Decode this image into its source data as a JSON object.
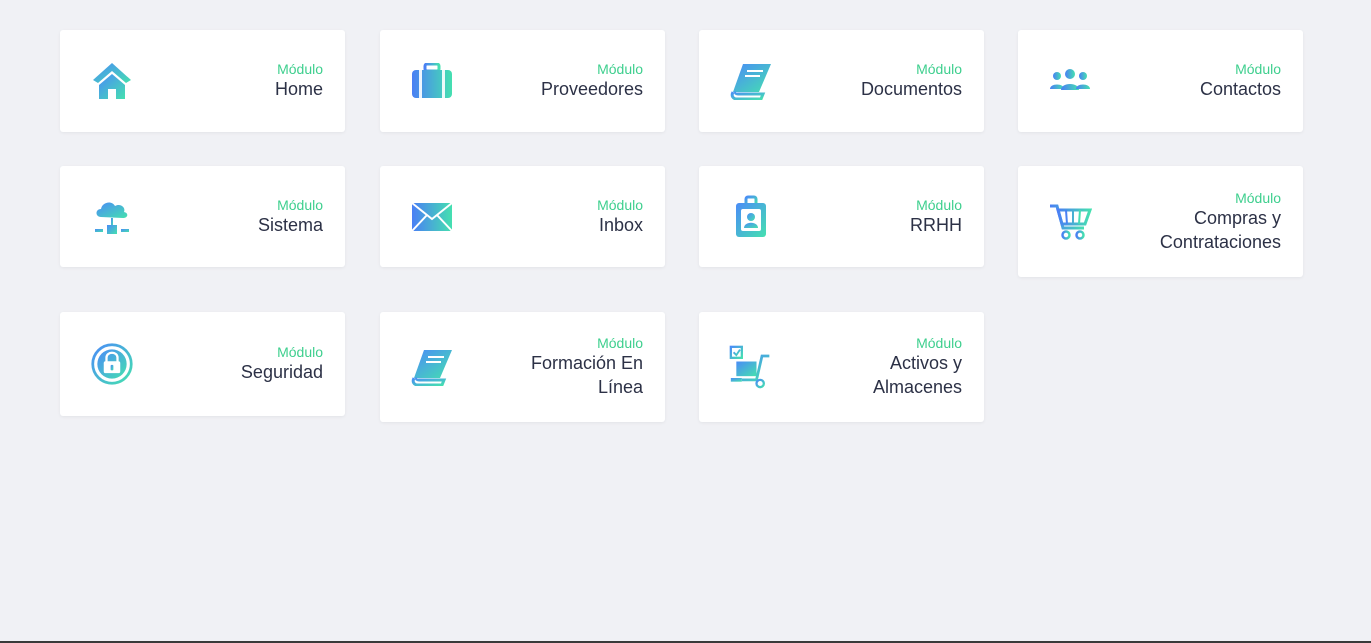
{
  "theme": {
    "accent": "#3ecf8e",
    "title_color": "#2c3146",
    "icon_gradient": [
      "#4facfe",
      "#43e3a6"
    ],
    "background": "#f0f1f5"
  },
  "modules": [
    {
      "kicker": "Módulo",
      "title": "Home",
      "icon": "home-icon"
    },
    {
      "kicker": "Módulo",
      "title": "Proveedores",
      "icon": "briefcase-icon"
    },
    {
      "kicker": "Módulo",
      "title": "Documentos",
      "icon": "book-icon"
    },
    {
      "kicker": "Módulo",
      "title": "Contactos",
      "icon": "users-icon"
    },
    {
      "kicker": "Módulo",
      "title": "Sistema",
      "icon": "cloud-network-icon"
    },
    {
      "kicker": "Módulo",
      "title": "Inbox",
      "icon": "envelope-icon"
    },
    {
      "kicker": "Módulo",
      "title": "RRHH",
      "icon": "id-badge-icon"
    },
    {
      "kicker": "Módulo",
      "title_line1": "Compras y",
      "title_line2": "Contrataciones",
      "icon": "shopping-cart-icon"
    },
    {
      "kicker": "Módulo",
      "title": "Seguridad",
      "icon": "lock-icon"
    },
    {
      "kicker": "Módulo",
      "title_line1": "Formación En",
      "title_line2": "Línea",
      "icon": "book-icon"
    },
    {
      "kicker": "Módulo",
      "title_line1": "Activos y",
      "title_line2": "Almacenes",
      "icon": "hand-truck-icon"
    }
  ]
}
